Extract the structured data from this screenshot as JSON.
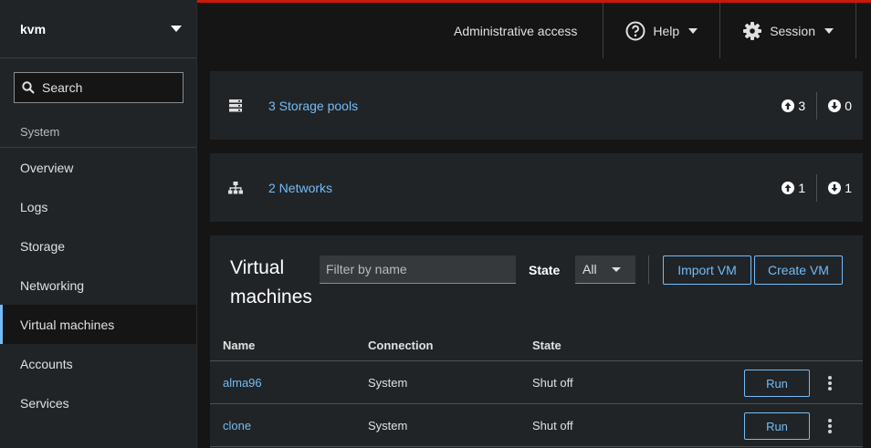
{
  "sidebar": {
    "host": "kvm",
    "search_placeholder": "Search",
    "section": "System",
    "items": [
      {
        "label": "Overview"
      },
      {
        "label": "Logs"
      },
      {
        "label": "Storage"
      },
      {
        "label": "Networking"
      },
      {
        "label": "Virtual machines",
        "active": true
      },
      {
        "label": "Accounts"
      },
      {
        "label": "Services"
      }
    ]
  },
  "topbar": {
    "admin": "Administrative access",
    "help": "Help",
    "session": "Session",
    "accent": "#c9190b"
  },
  "storage_pools": {
    "label": "3 Storage pools",
    "up": "3",
    "down": "0",
    "icon": "storage-pools-icon"
  },
  "networks": {
    "label": "2 Networks",
    "up": "1",
    "down": "1",
    "icon": "network-icon"
  },
  "vms": {
    "title": "Virtual machines",
    "filter_placeholder": "Filter by name",
    "state_label": "State",
    "state_value": "All",
    "import_label": "Import VM",
    "create_label": "Create VM",
    "columns": [
      "Name",
      "Connection",
      "State"
    ],
    "rows": [
      {
        "name": "alma96",
        "connection": "System",
        "state": "Shut off",
        "action": "Run"
      },
      {
        "name": "clone",
        "connection": "System",
        "state": "Shut off",
        "action": "Run"
      }
    ]
  },
  "colors": {
    "link": "#73bcf7",
    "background": "#151515",
    "panel": "#212427"
  }
}
